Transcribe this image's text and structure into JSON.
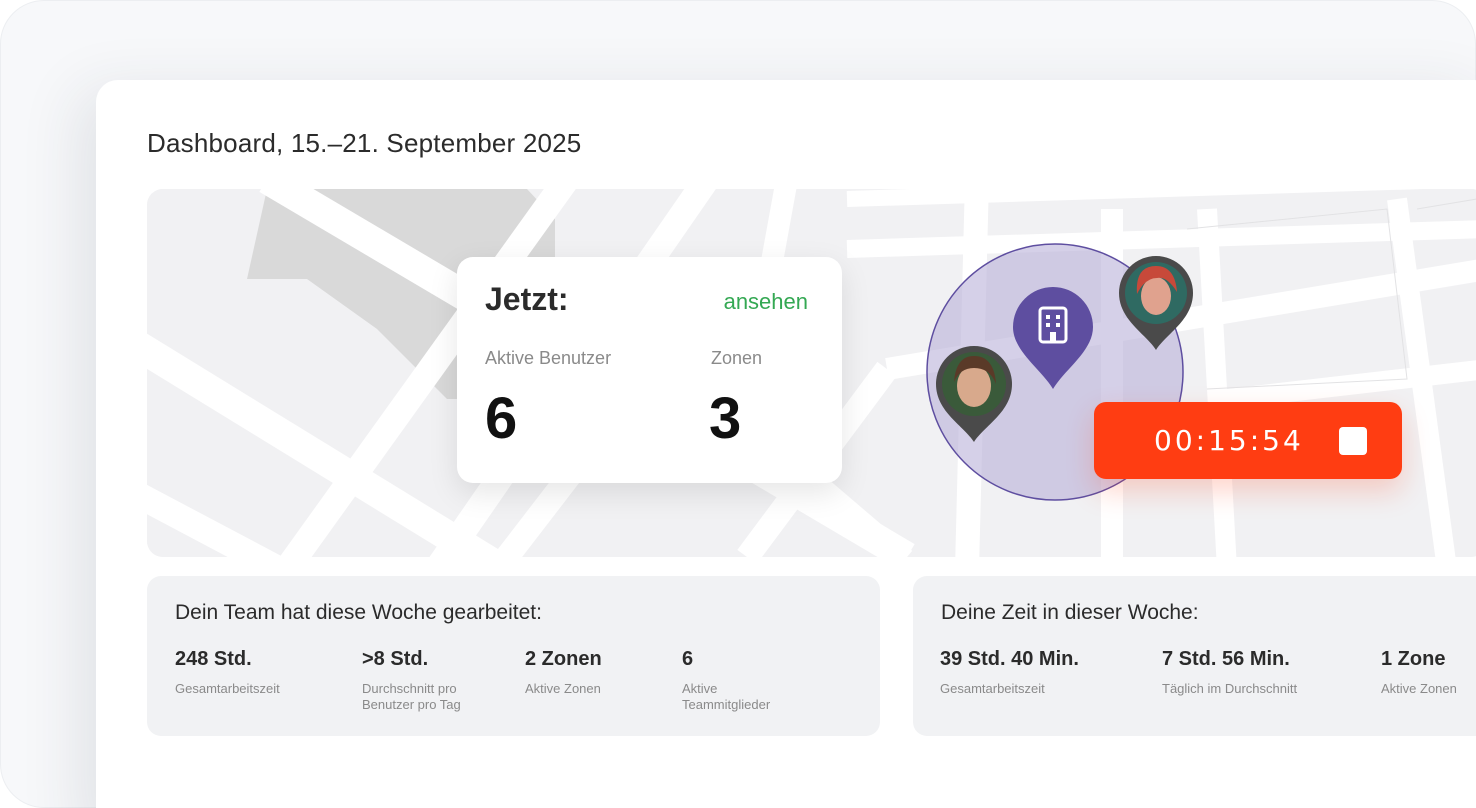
{
  "header": {
    "title": "Dashboard, 15.–21. September 2025"
  },
  "now_card": {
    "label": "Jetzt:",
    "link": "ansehen",
    "active_users_label": "Aktive Benutzer",
    "active_users_value": "6",
    "zones_label": "Zonen",
    "zones_value": "3"
  },
  "timer": {
    "value": "00:15:54",
    "stop_icon": "stop-icon"
  },
  "map": {
    "zone_color": "#6b5fa8",
    "pin_icon": "building-icon",
    "avatars": [
      "user-avatar-1",
      "user-avatar-2"
    ]
  },
  "team_panel": {
    "title": "Dein Team hat diese Woche gearbeitet:",
    "metrics": [
      {
        "value": "248 Std.",
        "caption": "Gesamtarbeitszeit"
      },
      {
        "value": ">8 Std.",
        "caption": "Durchschnitt pro Benutzer pro Tag"
      },
      {
        "value": "2 Zonen",
        "caption": "Aktive Zonen"
      },
      {
        "value": "6",
        "caption": "Aktive Teammitglieder"
      }
    ]
  },
  "my_panel": {
    "title": "Deine Zeit in dieser Woche:",
    "metrics": [
      {
        "value": "39 Std. 40 Min.",
        "caption": "Gesamtarbeitszeit"
      },
      {
        "value": "7 Std. 56 Min.",
        "caption": "Täglich im Durchschnitt"
      },
      {
        "value": "1 Zone",
        "caption": "Aktive Zonen"
      }
    ]
  },
  "colors": {
    "accent_green": "#34a853",
    "timer_red": "#ff3d12",
    "zone_purple": "#5e4ea0"
  }
}
